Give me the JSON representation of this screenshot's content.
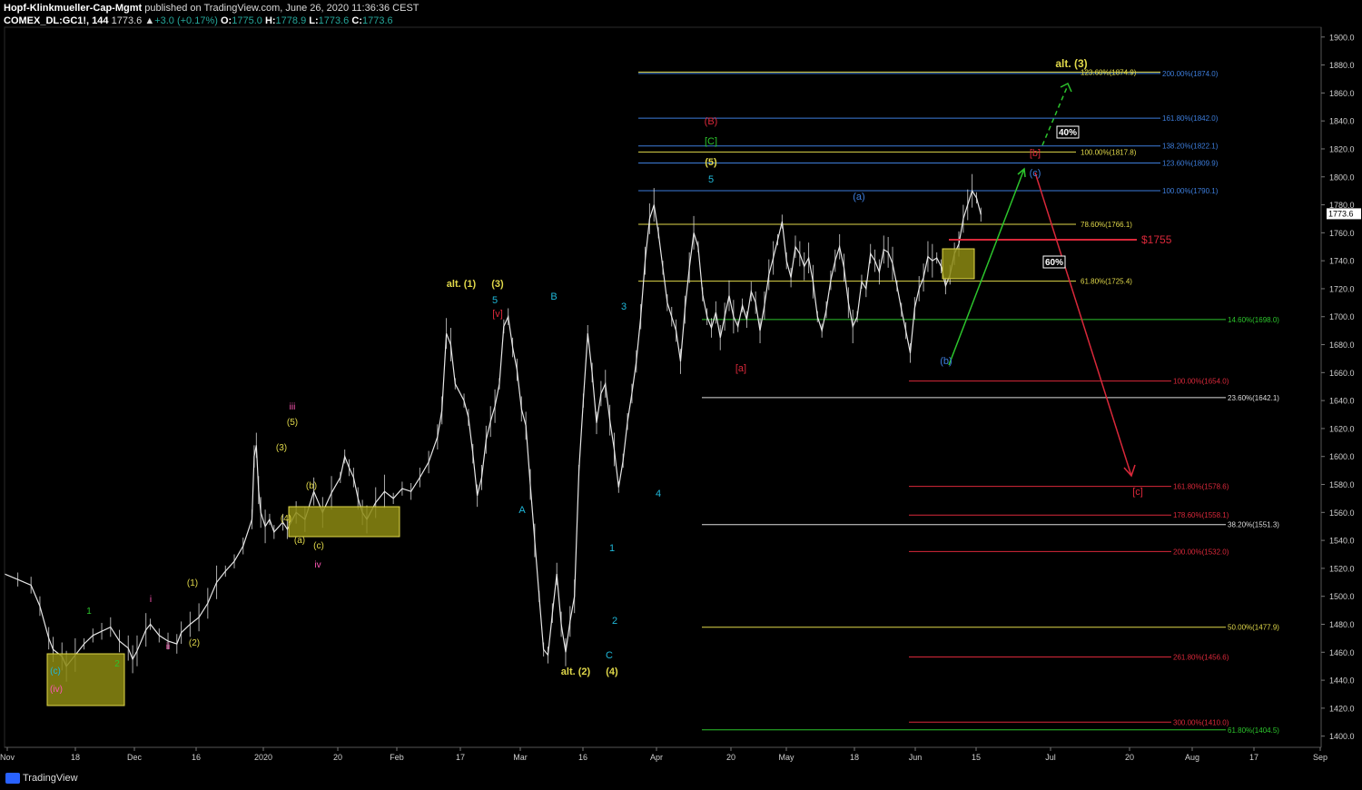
{
  "header": {
    "author": "Hopf-Klinkmueller-Cap-Mgmt",
    "published": " published on TradingView.com, June 26, 2020 11:36:36 CEST",
    "symbol": "COMEX_DL:GC1!, 144",
    "last": "1773.6",
    "change": "+3.0 (+0.17%)",
    "open": "1775.0",
    "high": "1778.9",
    "low": "1773.6",
    "close": "1773.6",
    "o_label": "O:",
    "h_label": "H:",
    "l_label": "L:",
    "c_label": "C:"
  },
  "footer": {
    "brand": "TradingView"
  },
  "colors": {
    "background": "#000000",
    "candles": "#e6e6e6",
    "yellow": "#e0d84a",
    "blue": "#3d7ddb",
    "green": "#2cc42c",
    "red": "#d9283a",
    "cyan": "#1fb7d8",
    "pink": "#ff57b5"
  },
  "chart_data": {
    "type": "line",
    "title": "",
    "xlabel": "",
    "ylabel": "",
    "ylim": [
      1392,
      1907
    ],
    "current_price": "1773.6",
    "y_ticks": [
      1900,
      1880,
      1860,
      1840,
      1820,
      1800,
      1780,
      1760,
      1740,
      1720,
      1700,
      1680,
      1660,
      1640,
      1620,
      1600,
      1580,
      1560,
      1540,
      1520,
      1500,
      1480,
      1460,
      1440,
      1420,
      1400
    ],
    "x_ticks": [
      "Nov",
      "18",
      "Dec",
      "16",
      "2020",
      "20",
      "Feb",
      "17",
      "Mar",
      "16",
      "Apr",
      "20",
      "May",
      "18",
      "Jun",
      "15",
      "Jul",
      "20",
      "Aug",
      "17",
      "Sep"
    ],
    "series": [
      {
        "values": [
          [
            0,
            1516
          ],
          [
            3,
            1512
          ],
          [
            6,
            1508
          ],
          [
            8,
            1493
          ],
          [
            10,
            1470
          ],
          [
            11,
            1462
          ],
          [
            13,
            1457
          ],
          [
            14,
            1450
          ],
          [
            16,
            1458
          ],
          [
            18,
            1466
          ],
          [
            20,
            1472
          ],
          [
            22,
            1475
          ],
          [
            24,
            1478
          ],
          [
            26,
            1468
          ],
          [
            28,
            1463
          ],
          [
            29,
            1455
          ],
          [
            30,
            1461
          ],
          [
            32,
            1476
          ],
          [
            33,
            1480
          ],
          [
            35,
            1472
          ],
          [
            37,
            1468
          ],
          [
            39,
            1466
          ],
          [
            40,
            1474
          ],
          [
            42,
            1480
          ],
          [
            44,
            1485
          ],
          [
            46,
            1495
          ],
          [
            48,
            1510
          ],
          [
            50,
            1518
          ],
          [
            52,
            1525
          ],
          [
            54,
            1536
          ],
          [
            56,
            1555
          ],
          [
            56.5,
            1600
          ],
          [
            57,
            1608
          ],
          [
            57.5,
            1576
          ],
          [
            58,
            1560
          ],
          [
            59,
            1550
          ],
          [
            60,
            1555
          ],
          [
            61,
            1546
          ],
          [
            63,
            1553
          ],
          [
            64,
            1548
          ],
          [
            66,
            1560
          ],
          [
            68,
            1555
          ],
          [
            70,
            1575
          ],
          [
            72,
            1560
          ],
          [
            74,
            1574
          ],
          [
            76,
            1585
          ],
          [
            77,
            1600
          ],
          [
            78,
            1592
          ],
          [
            79,
            1585
          ],
          [
            80,
            1570
          ],
          [
            81,
            1560
          ],
          [
            82,
            1555
          ],
          [
            84,
            1567
          ],
          [
            86,
            1575
          ],
          [
            88,
            1570
          ],
          [
            90,
            1577
          ],
          [
            92,
            1575
          ],
          [
            94,
            1585
          ],
          [
            96,
            1596
          ],
          [
            98,
            1614
          ],
          [
            99,
            1633
          ],
          [
            100,
            1688
          ],
          [
            101,
            1680
          ],
          [
            102,
            1652
          ],
          [
            104,
            1640
          ],
          [
            105,
            1628
          ],
          [
            106,
            1602
          ],
          [
            107,
            1572
          ],
          [
            108,
            1585
          ],
          [
            109,
            1612
          ],
          [
            110,
            1625
          ],
          [
            111,
            1636
          ],
          [
            112,
            1652
          ],
          [
            113,
            1693
          ],
          [
            114,
            1700
          ],
          [
            115,
            1678
          ],
          [
            116,
            1662
          ],
          [
            117,
            1634
          ],
          [
            118,
            1622
          ],
          [
            119,
            1580
          ],
          [
            120,
            1540
          ],
          [
            121,
            1500
          ],
          [
            122,
            1462
          ],
          [
            123,
            1458
          ],
          [
            124,
            1488
          ],
          [
            125,
            1516
          ],
          [
            126,
            1480
          ],
          [
            127,
            1460
          ],
          [
            128,
            1482
          ],
          [
            129,
            1500
          ],
          [
            130,
            1590
          ],
          [
            131,
            1640
          ],
          [
            132,
            1688
          ],
          [
            133,
            1660
          ],
          [
            134,
            1624
          ],
          [
            135,
            1645
          ],
          [
            136,
            1652
          ],
          [
            137,
            1626
          ],
          [
            138,
            1605
          ],
          [
            139,
            1578
          ],
          [
            140,
            1597
          ],
          [
            141,
            1625
          ],
          [
            142,
            1645
          ],
          [
            143,
            1668
          ],
          [
            144,
            1700
          ],
          [
            145,
            1740
          ],
          [
            146,
            1770
          ],
          [
            147,
            1780
          ],
          [
            148,
            1760
          ],
          [
            149,
            1735
          ],
          [
            150,
            1710
          ],
          [
            151,
            1700
          ],
          [
            152,
            1690
          ],
          [
            153,
            1668
          ],
          [
            154,
            1705
          ],
          [
            155,
            1735
          ],
          [
            156,
            1760
          ],
          [
            157,
            1750
          ],
          [
            158,
            1716
          ],
          [
            159,
            1700
          ],
          [
            160,
            1692
          ],
          [
            161,
            1703
          ],
          [
            162,
            1685
          ],
          [
            163,
            1700
          ],
          [
            164,
            1715
          ],
          [
            165,
            1700
          ],
          [
            166,
            1693
          ],
          [
            167,
            1708
          ],
          [
            168,
            1698
          ],
          [
            169,
            1718
          ],
          [
            170,
            1710
          ],
          [
            171,
            1690
          ],
          [
            172,
            1708
          ],
          [
            173,
            1730
          ],
          [
            174,
            1742
          ],
          [
            175,
            1755
          ],
          [
            176,
            1768
          ],
          [
            177,
            1740
          ],
          [
            178,
            1728
          ],
          [
            179,
            1750
          ],
          [
            180,
            1745
          ],
          [
            181,
            1736
          ],
          [
            182,
            1742
          ],
          [
            183,
            1725
          ],
          [
            184,
            1700
          ],
          [
            185,
            1690
          ],
          [
            186,
            1705
          ],
          [
            187,
            1726
          ],
          [
            188,
            1740
          ],
          [
            189,
            1750
          ],
          [
            190,
            1735
          ],
          [
            191,
            1710
          ],
          [
            192,
            1693
          ],
          [
            193,
            1700
          ],
          [
            194,
            1725
          ],
          [
            195,
            1720
          ],
          [
            196,
            1745
          ],
          [
            197,
            1740
          ],
          [
            198,
            1732
          ],
          [
            199,
            1748
          ],
          [
            200,
            1746
          ],
          [
            201,
            1738
          ],
          [
            202,
            1722
          ],
          [
            203,
            1705
          ],
          [
            204,
            1690
          ],
          [
            205,
            1674
          ],
          [
            206,
            1706
          ],
          [
            207,
            1720
          ],
          [
            208,
            1728
          ],
          [
            209,
            1743
          ],
          [
            210,
            1740
          ],
          [
            211,
            1742
          ],
          [
            212,
            1736
          ],
          [
            213,
            1722
          ],
          [
            214,
            1730
          ],
          [
            215,
            1745
          ],
          [
            216,
            1752
          ],
          [
            217,
            1770
          ],
          [
            218,
            1780
          ],
          [
            219,
            1790
          ],
          [
            220,
            1785
          ],
          [
            221,
            1773
          ]
        ]
      }
    ],
    "horizontal_levels": [
      {
        "label": "200.00%(1874.0)",
        "value": 1874.0,
        "color": "#3d7ddb"
      },
      {
        "label": "123.60%(1874.9)",
        "value": 1874.9,
        "color": "#e0d84a"
      },
      {
        "label": "161.80%(1842.0)",
        "value": 1842.0,
        "color": "#3d7ddb"
      },
      {
        "label": "138.20%(1822.1)",
        "value": 1822.1,
        "color": "#3d7ddb"
      },
      {
        "label": "100.00%(1817.8)",
        "value": 1817.8,
        "color": "#e0d84a"
      },
      {
        "label": "123.60%(1809.9)",
        "value": 1809.9,
        "color": "#3d7ddb"
      },
      {
        "label": "100.00%(1790.1)",
        "value": 1790.1,
        "color": "#3d7ddb"
      },
      {
        "label": "78.60%(1766.1)",
        "value": 1766.1,
        "color": "#e0d84a"
      },
      {
        "label": "61.80%(1725.4)",
        "value": 1725.4,
        "color": "#e0d84a"
      },
      {
        "label": "14.60%(1698.0)",
        "value": 1698.0,
        "color": "#2cc42c"
      },
      {
        "label": "100.00%(1654.0)",
        "value": 1654.0,
        "color": "#d9283a"
      },
      {
        "label": "23.60%(1642.1)",
        "value": 1642.1,
        "color": "#dddddd"
      },
      {
        "label": "161.80%(1578.6)",
        "value": 1578.6,
        "color": "#d9283a"
      },
      {
        "label": "178.60%(1558.1)",
        "value": 1558.1,
        "color": "#d9283a"
      },
      {
        "label": "38.20%(1551.3)",
        "value": 1551.3,
        "color": "#dddddd"
      },
      {
        "label": "200.00%(1532.0)",
        "value": 1532.0,
        "color": "#d9283a"
      },
      {
        "label": "50.00%(1477.9)",
        "value": 1477.9,
        "color": "#e0d84a"
      },
      {
        "label": "261.80%(1456.6)",
        "value": 1456.6,
        "color": "#d9283a"
      },
      {
        "label": "300.00%(1410.0)",
        "value": 1410.0,
        "color": "#d9283a"
      },
      {
        "label": "61.80%(1404.5)",
        "value": 1404.5,
        "color": "#2cc42c"
      }
    ],
    "annotations": {
      "price_1755": "$1755",
      "pct_40": "40%",
      "pct_60": "60%",
      "alt3": "alt. (3)",
      "alt1": "alt. (1)",
      "alt2": "alt. (2)",
      "w3": "(3)",
      "w4": "(4)",
      "w5": "(5)",
      "w1": "(1)",
      "w2": "(2)",
      "B_big": "(B)",
      "C_big": "[C]",
      "rv": "[v]",
      "ra": "[a]",
      "rb": "[b]",
      "rc": "[c]",
      "A": "A",
      "B": "B",
      "C": "C",
      "n1": "1",
      "n2": "2",
      "n3": "3",
      "n4": "4",
      "n5": "5",
      "la": "(a)",
      "lb": "(b)",
      "lc": "(c)",
      "i": "i",
      "ii": "ii",
      "iii": "iii",
      "iv": "iv",
      "gn1": "1",
      "gn2": "2",
      "pink_iv": "(iv)"
    }
  }
}
